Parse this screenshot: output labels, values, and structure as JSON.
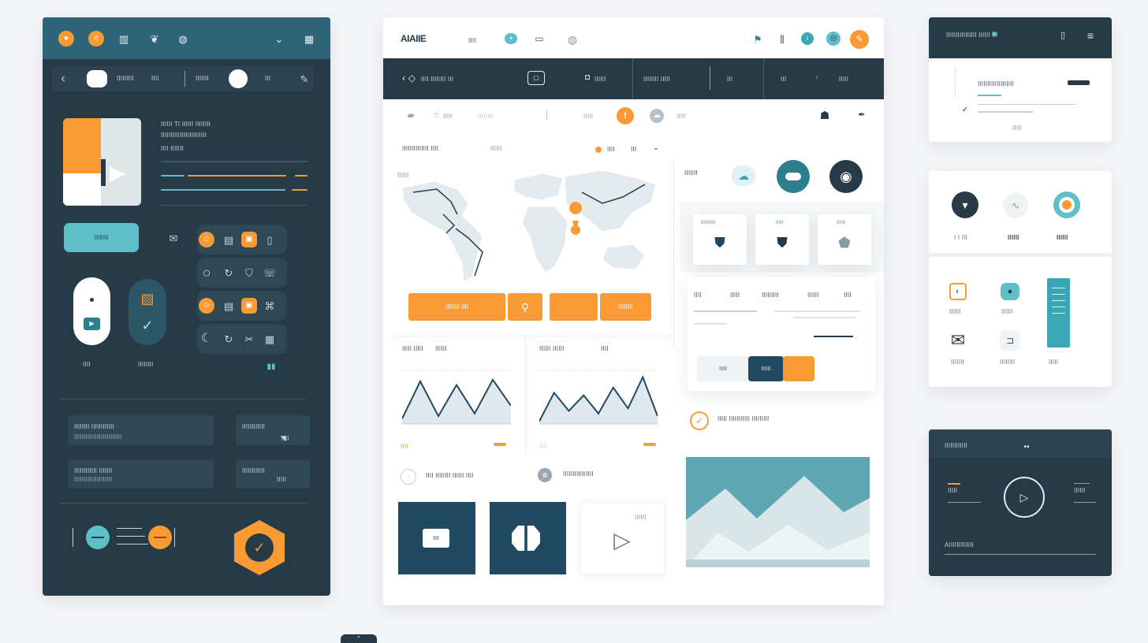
{
  "left_panel": {
    "topbar_icons": [
      "logo-icon",
      "brand-icon",
      "chart-icon",
      "leaf-icon",
      "globe-icon",
      "chevron-down-icon",
      "grid-icon"
    ],
    "nav": {
      "back_label": "‹",
      "search_pill": "",
      "item1": "IIIIIIIII",
      "item2": "IIII",
      "item3": "IIIIIII",
      "item4": "III"
    },
    "media": {
      "title_line1": "IIIIII TI IIIIII IIIIIIII",
      "title_line2": "IIIIIIIIIIIIIIIIIIIIIIII",
      "meta": "IIII IIIIIII",
      "progress_pct": 78
    },
    "primary_button": "IIIIIIII",
    "toggle_label_1": "IIII",
    "toggle_label_2": "IIIIIIII",
    "rows": [
      {
        "title": "IIIIIIII IIIIIIIIIIII",
        "sub": "IIIIIIIIIIIIIIIIIIIIIIIII",
        "right_title": "IIIIIIIIIIII",
        "right_value": "IIII"
      },
      {
        "title": "IIIIIIIIIIII IIIIIII",
        "sub": "IIIIIIIIIIIIIIIIIIII",
        "right_title": "IIIIIIIIIIII",
        "right_value": "IIIII"
      }
    ],
    "footer_text": "IIIIIIIIII"
  },
  "center_panel": {
    "app_title": "AIAIIE",
    "top_link": "IIII",
    "dark_bar": {
      "back_label": "‹ ◇",
      "title": "IIII IIIIIIII III",
      "item1": "IIIIII",
      "item2": "IIIIIIII  IIIII",
      "item3": "III",
      "item4": "III",
      "item5": "IIIII"
    },
    "filter_row": {
      "item1": "IIIII",
      "item2": "IIIIIIII",
      "item3": "IIIII",
      "item4": "IIIII"
    },
    "map": {
      "header": "IIIIIIIIIIIIII IIII",
      "header2": "IIIIII",
      "legend1": "IIII",
      "legend2": "III",
      "corner_label": "IIIIII"
    },
    "map_buttons": [
      "IIIIIIII IIII",
      "",
      "",
      "IIIIIIII"
    ],
    "icon_group_label": "IIIIIII",
    "metric_cards": [
      {
        "label": "IIIIIIIIII"
      },
      {
        "label": "IIIII"
      },
      {
        "label": "IIIIII"
      }
    ],
    "list_row": {
      "labels": [
        "IIII",
        "IIIII",
        "IIIIIIIII",
        "IIIIII",
        "IIII"
      ]
    },
    "seg_buttons": [
      "IIIII",
      "IIIIII",
      ""
    ],
    "confirm_text": "IIIII IIIIIIIIIII IIIIIIIII",
    "chart_left": {
      "header1": "IIIII IIIII",
      "header2": "IIIIII",
      "footer": "IIII",
      "values": [
        0.1,
        0.82,
        0.15,
        0.75,
        0.2,
        0.85,
        0.35
      ]
    },
    "chart_right": {
      "header1": "IIIIII IIIIII",
      "header2": "IIII",
      "footer": "IIII",
      "values": [
        0.05,
        0.6,
        0.25,
        0.55,
        0.2,
        0.7,
        0.3,
        0.9,
        0.15
      ]
    },
    "bottom_rows": [
      "IIII IIIIIIII IIIIII IIII",
      "IIIIIIIIIIIIIIII"
    ],
    "bottom_tiles": [
      "IIII",
      "",
      "IIIIII"
    ]
  },
  "right_panel": {
    "card1": {
      "title": "IIIIIIIIIIIIIIII IIIIII III",
      "row_title": "IIIIIIIIIIIIIIIIIII",
      "row_sub": "IIIII"
    },
    "card2": {
      "labels": [
        "I I III",
        "IIIIII",
        "IIIIII"
      ],
      "grid_labels": [
        "IIIIII",
        "IIIIII",
        "IIIIIII",
        "IIIIIIII",
        "IIIII"
      ]
    },
    "card3": {
      "title": "IIIIIIIIIIII",
      "left_title": "IIIII",
      "right_title": "IIIIII",
      "footer": "AIIIIIIIIIIIII"
    }
  },
  "colors": {
    "navy": "#263a48",
    "teal": "#5fbfc9",
    "orange": "#f99a33",
    "deep": "#1f4a62"
  }
}
